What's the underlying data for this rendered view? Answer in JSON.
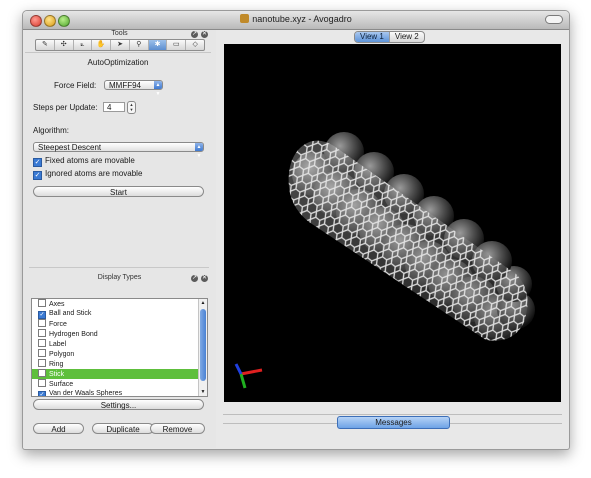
{
  "window": {
    "title": "nanotube.xyz - Avogadro"
  },
  "tools_dock": {
    "title": "Tools",
    "toolbar_icons": [
      "draw-icon",
      "navigate-icon",
      "measure-icon",
      "manipulate-icon",
      "select-icon",
      "bond-centric-icon",
      "auto-optimization-icon",
      "align-icon",
      "symmetry-icon"
    ],
    "toolbar_glyphs": [
      "✎",
      "✣",
      "⟀",
      "✋",
      "➤",
      "⚲",
      "✱",
      "▭",
      "◇"
    ],
    "active_tool_index": 6,
    "panel_title": "AutoOptimization",
    "force_field_label": "Force Field:",
    "force_field_value": "MMFF94",
    "steps_label": "Steps per Update:",
    "steps_value": "4",
    "algorithm_label": "Algorithm:",
    "algorithm_value": "Steepest Descent",
    "fixed_atoms_label": "Fixed atoms are movable",
    "fixed_atoms_checked": true,
    "ignored_atoms_label": "Ignored atoms are movable",
    "ignored_atoms_checked": true,
    "start_label": "Start"
  },
  "display_dock": {
    "title": "Display Types",
    "items": [
      {
        "label": "Axes",
        "checked": false,
        "selected": false
      },
      {
        "label": "Ball and Stick",
        "checked": true,
        "selected": false
      },
      {
        "label": "Force",
        "checked": false,
        "selected": false
      },
      {
        "label": "Hydrogen Bond",
        "checked": false,
        "selected": false
      },
      {
        "label": "Label",
        "checked": false,
        "selected": false
      },
      {
        "label": "Polygon",
        "checked": false,
        "selected": false
      },
      {
        "label": "Ring",
        "checked": false,
        "selected": false
      },
      {
        "label": "Stick",
        "checked": false,
        "selected": true
      },
      {
        "label": "Surface",
        "checked": false,
        "selected": false
      },
      {
        "label": "Van der Waals Spheres",
        "checked": true,
        "selected": false
      }
    ],
    "settings_label": "Settings...",
    "add_label": "Add",
    "duplicate_label": "Duplicate",
    "remove_label": "Remove"
  },
  "views": {
    "tabs": [
      "View 1",
      "View 2"
    ],
    "active_index": 0
  },
  "messages_label": "Messages",
  "colors": {
    "viewport_bg": "#000000",
    "selection": "#5ebf3c",
    "accent": "#3f79d0"
  }
}
